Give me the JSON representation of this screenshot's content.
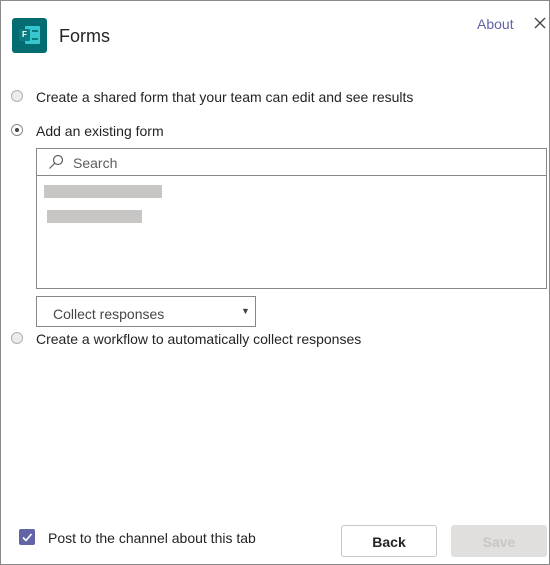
{
  "header": {
    "app_icon": "microsoft-forms-icon",
    "app_icon_letter": "F",
    "title": "Forms",
    "about_label": "About",
    "close_icon": "close-icon"
  },
  "options": {
    "shared_form_label": "Create a shared form that your team can edit and see results",
    "existing_form_label": "Add an existing form",
    "workflow_label": "Create a workflow to automatically collect responses",
    "selected": "existing_form"
  },
  "form_picker": {
    "search_placeholder": "Search",
    "search_value": "",
    "loading_placeholder_rows": 2
  },
  "workflow_dropdown": {
    "selected_value": "Collect responses"
  },
  "footer": {
    "post_to_channel_label": "Post to the channel about this tab",
    "post_to_channel_checked": true,
    "back_label": "Back",
    "save_label": "Save",
    "save_enabled": false
  },
  "colors": {
    "accent": "#6264a7",
    "forms_brand": "#036c70",
    "disabled_button": "#e1dfdd"
  }
}
